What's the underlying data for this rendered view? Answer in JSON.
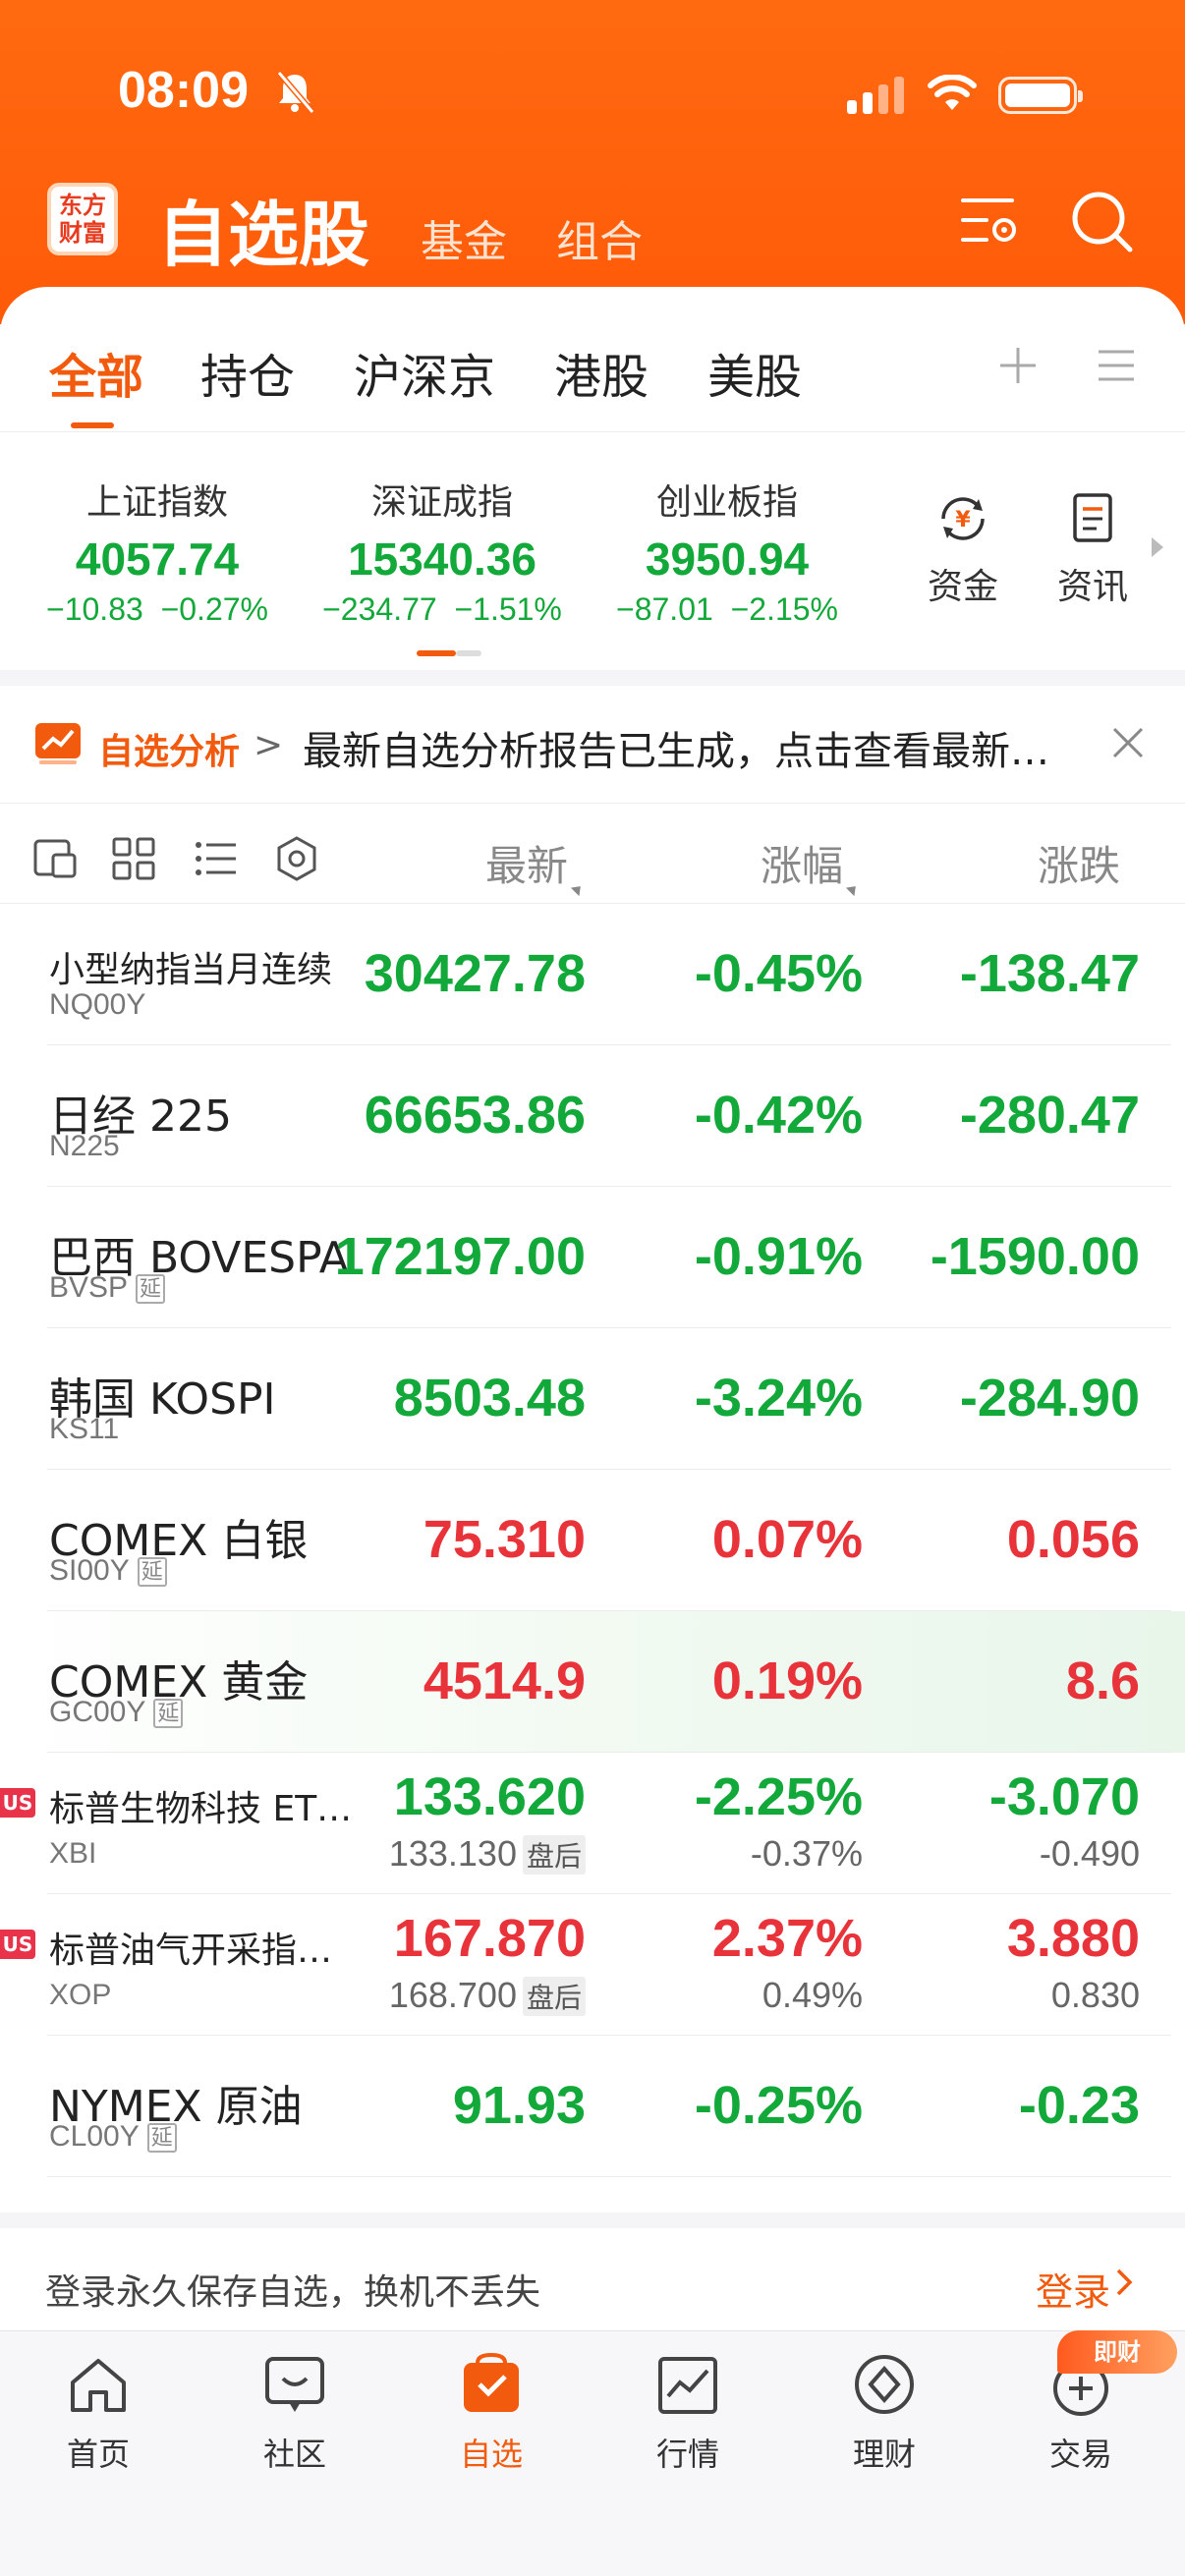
{
  "status": {
    "time": "08:09"
  },
  "header": {
    "logo_line1": "东方",
    "logo_line2": "财富",
    "title": "自选股",
    "sub_tabs": [
      "基金",
      "组合"
    ]
  },
  "tabs": [
    "全部",
    "持仓",
    "沪深京",
    "港股",
    "美股"
  ],
  "indices": [
    {
      "name": "上证指数",
      "value": "4057.74",
      "change": "−10.83",
      "pct": "−0.27%"
    },
    {
      "name": "深证成指",
      "value": "15340.36",
      "change": "−234.77",
      "pct": "−1.51%"
    },
    {
      "name": "创业板指",
      "value": "3950.94",
      "change": "−87.01",
      "pct": "−2.15%"
    }
  ],
  "side_buttons": [
    "资金",
    "资讯"
  ],
  "banner": {
    "tag": "自选分析",
    "chevron": ">",
    "text": "最新自选分析报告已生成，点击查看最新…"
  },
  "columns": {
    "latest": "最新",
    "pct": "涨幅",
    "change": "涨跌"
  },
  "rows": [
    {
      "name": "小型纳指当月连续",
      "code": "NQ00Y",
      "delay": "",
      "latest": "30427.78",
      "pct": "-0.45%",
      "chg": "-138.47"
    },
    {
      "name": "日经 225",
      "code": "N225",
      "delay": "",
      "latest": "66653.86",
      "pct": "-0.42%",
      "chg": "-280.47"
    },
    {
      "name": "巴西 BOVESPA",
      "code": "BVSP",
      "delay": "延",
      "latest": "172197.00",
      "pct": "-0.91%",
      "chg": "-1590.00"
    },
    {
      "name": "韩国 KOSPI",
      "code": "KS11",
      "delay": "",
      "latest": "8503.48",
      "pct": "-3.24%",
      "chg": "-284.90"
    },
    {
      "name": "COMEX 白银",
      "code": "SI00Y",
      "delay": "延",
      "latest": "75.310",
      "pct": "0.07%",
      "chg": "0.056"
    },
    {
      "name": "COMEX 黄金",
      "code": "GC00Y",
      "delay": "延",
      "latest": "4514.9",
      "pct": "0.19%",
      "chg": "8.6"
    },
    {
      "name": "标普生物科技 ET…",
      "code": "XBI",
      "badge": "US",
      "latest": "133.620",
      "pct": "-2.25%",
      "chg": "-3.070",
      "after_price": "133.130",
      "after_tag": "盘后",
      "after_pct": "-0.37%",
      "after_chg": "-0.490"
    },
    {
      "name": "标普油气开采指…",
      "code": "XOP",
      "badge": "US",
      "latest": "167.870",
      "pct": "2.37%",
      "chg": "3.880",
      "after_price": "168.700",
      "after_tag": "盘后",
      "after_pct": "0.49%",
      "after_chg": "0.830"
    },
    {
      "name": "NYMEX 原油",
      "code": "CL00Y",
      "delay": "延",
      "latest": "91.93",
      "pct": "-0.25%",
      "chg": "-0.23"
    }
  ],
  "login": {
    "text": "登录永久保存自选，换机不丢失",
    "button": "登录"
  },
  "nav": [
    "首页",
    "社区",
    "自选",
    "行情",
    "理财",
    "交易"
  ],
  "nav_badge": "即财",
  "colors": {
    "accent": "#f25a0d",
    "down": "#13a83a",
    "up": "#e8333a"
  }
}
